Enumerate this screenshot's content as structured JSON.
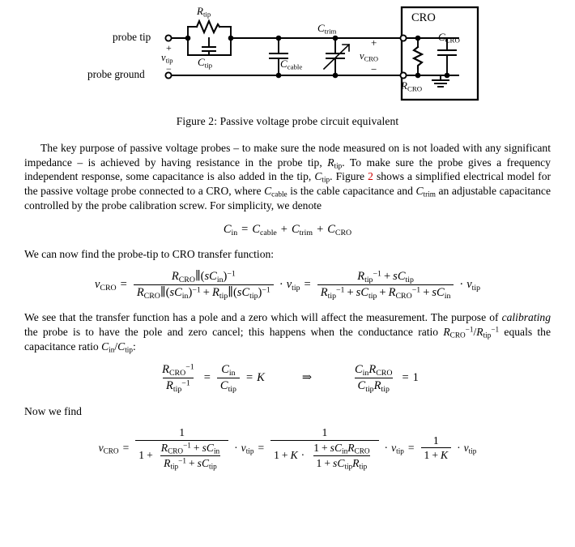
{
  "figure": {
    "caption": "Figure 2: Passive voltage probe circuit equivalent",
    "labels": {
      "probe_tip": "probe tip",
      "probe_ground": "probe ground",
      "v_tip": "v",
      "v_tip_sub": "tip",
      "plus_left": "+",
      "minus_left": "−",
      "r_tip": "R",
      "r_tip_sub": "tip",
      "c_tip": "C",
      "c_tip_sub": "tip",
      "c_cable": "C",
      "c_cable_sub": "cable",
      "c_trim": "C",
      "c_trim_sub": "trim",
      "v_cro": "v",
      "v_cro_sub": "CRO",
      "plus_right": "+",
      "minus_right": "−",
      "cro_box_title": "CRO",
      "r_cro": "R",
      "r_cro_sub": "CRO",
      "c_cro": "C",
      "c_cro_sub": "CRO"
    }
  },
  "paragraphs": {
    "p1_a": "The key purpose of passive voltage probes – to make sure the node measured on is not loaded with any significant impedance – is achieved by having resistance in the probe tip, ",
    "p1_r": "R",
    "p1_r_sub": "tip",
    "p1_b": ". To make sure the probe gives a frequency independent response, some capacitance is also added in the tip, ",
    "p1_c": "C",
    "p1_c_sub": "tip",
    "p1_d": ". Figure ",
    "p1_link": "2",
    "p1_e": " shows a simplified electrical model for the passive voltage probe connected to a CRO, where ",
    "p1_ccable": "C",
    "p1_ccable_sub": "cable",
    "p1_f": " is the cable capacitance and ",
    "p1_ctrim": "C",
    "p1_ctrim_sub": "trim",
    "p1_g": " an adjustable capacitance controlled by the probe calibration screw. For simplicity, we denote",
    "p2": "We can now find the probe-tip to CRO transfer function:",
    "p3_a": "We see that the transfer function has a pole and a zero which will affect the measurement. The purpose of ",
    "p3_it": "calibrating",
    "p3_b": " the probe is to have the pole and zero cancel; this happens when the conductance ratio ",
    "p3_rcro": "R",
    "p3_rcro_sub": "CRO",
    "p3_exp": "−1",
    "p3_slash": "/",
    "p3_rtip": "R",
    "p3_rtip_sub": "tip",
    "p3_c": " equals the capacitance ratio ",
    "p3_cin": "C",
    "p3_cin_sub": "in",
    "p3_cslash": "/",
    "p3_ctip": "C",
    "p3_ctip_sub": "tip",
    "p3_d": ":",
    "p4": "Now we find"
  },
  "equations": {
    "eq1": {
      "c_in": "C",
      "c_in_sub": "in",
      "eq": "=",
      "c_cable": "C",
      "c_cable_sub": "cable",
      "plus1": "+",
      "c_trim": "C",
      "c_trim_sub": "trim",
      "plus2": "+",
      "c_cro": "C",
      "c_cro_sub": "CRO"
    },
    "eq2": {
      "v_cro": "v",
      "v_cro_sub": "CRO",
      "eq1": "=",
      "num1_rcro": "R",
      "num1_rcro_sub": "CRO",
      "par": "∥",
      "lp": "(",
      "s": "s",
      "c_in": "C",
      "c_in_sub": "in",
      "rp": ")",
      "exp_m1": "−1",
      "den1_rcro": "R",
      "den1_rcro_sub": "CRO",
      "den1_plus": "+",
      "den1_rtip": "R",
      "den1_rtip_sub": "tip",
      "c_tip": "C",
      "c_tip_sub": "tip",
      "dot": "·",
      "v_tip": "v",
      "v_tip_sub": "tip",
      "eq2": "=",
      "num2_rtip": "R",
      "num2_rtip_sub": "tip",
      "num2_exp": "−1",
      "num2_plus": "+",
      "num2_s": "s",
      "num2_ctip": "C",
      "num2_ctip_sub": "tip",
      "den2_rtip": "R",
      "den2_rtip_sub": "tip",
      "den2_exp": "−1",
      "den2_plus1": "+",
      "den2_s1": "s",
      "den2_ctip": "C",
      "den2_ctip_sub": "tip",
      "den2_plus2": "+",
      "den2_rcro": "R",
      "den2_rcro_sub": "CRO",
      "den2_exp2": "−1",
      "den2_plus3": "+",
      "den2_s2": "s",
      "den2_cin": "C",
      "den2_cin_sub": "in"
    },
    "eq3": {
      "rcro": "R",
      "rcro_sub": "CRO",
      "rcro_exp": "−1",
      "rtip": "R",
      "rtip_sub": "tip",
      "rtip_exp": "−1",
      "eq1": "=",
      "cin": "C",
      "cin_sub": "in",
      "ctip": "C",
      "ctip_sub": "tip",
      "eq2": "=",
      "k": "K",
      "arrow": "⇒",
      "cin2": "C",
      "cin2_sub": "in",
      "rcro2": "R",
      "rcro2_sub": "CRO",
      "ctip2": "C",
      "ctip2_sub": "tip",
      "rtip2": "R",
      "rtip2_sub": "tip",
      "eq3": "=",
      "one": "1"
    },
    "eq4": {
      "v_cro": "v",
      "v_cro_sub": "CRO",
      "eq1": "=",
      "one_a": "1",
      "one_b": "1",
      "plus_a": "+",
      "f_rcro": "R",
      "f_rcro_sub": "CRO",
      "f_rcro_exp": "−1",
      "f_plus1": "+",
      "f_s1": "s",
      "f_cin": "C",
      "f_cin_sub": "in",
      "f_rtip": "R",
      "f_rtip_sub": "tip",
      "f_rtip_exp": "−1",
      "f_plus2": "+",
      "f_s2": "s",
      "f_ctip": "C",
      "f_ctip_sub": "tip",
      "dot1": "·",
      "v_tip1": "v",
      "v_tip1_sub": "tip",
      "eq2": "=",
      "one_c": "1",
      "one_d": "1",
      "plus_b": "+",
      "k": "K",
      "dot2": "·",
      "g_one1": "1",
      "g_plus1": "+",
      "g_s1": "s",
      "g_cin": "C",
      "g_cin_sub": "in",
      "g_rcro": "R",
      "g_rcro_sub": "CRO",
      "g_one2": "1",
      "g_plus2": "+",
      "g_s2": "s",
      "g_ctip": "C",
      "g_ctip_sub": "tip",
      "g_rtip": "R",
      "g_rtip_sub": "tip",
      "dot3": "·",
      "v_tip2": "v",
      "v_tip2_sub": "tip",
      "eq3": "=",
      "one_e": "1",
      "one_f": "1",
      "plus_c": "+",
      "k2": "K",
      "dot4": "·",
      "v_tip3": "v",
      "v_tip3_sub": "tip"
    }
  },
  "colors": {
    "link": "#cc0000",
    "text": "#000000",
    "background": "#ffffff"
  }
}
